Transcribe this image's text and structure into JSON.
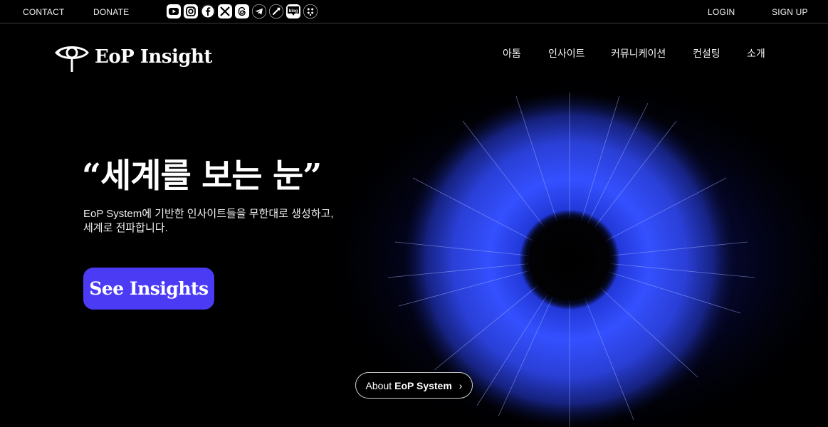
{
  "utility": {
    "contact": "CONTACT",
    "donate": "DONATE",
    "login": "LOGIN",
    "signup": "SIGN UP"
  },
  "social_icons": [
    "youtube-icon",
    "instagram-icon",
    "facebook-icon",
    "x-icon",
    "threads-icon",
    "telegram-icon",
    "link-icon",
    "blog-icon",
    "linktree-icon"
  ],
  "social_blog_label": "blog",
  "logo": {
    "text": "EoP Insight"
  },
  "nav": {
    "items": [
      "아톰",
      "인사이트",
      "커뮤니케이션",
      "컨설팅",
      "소개"
    ]
  },
  "hero": {
    "title": "“세계를 보는 눈”",
    "subtitle_line1": "EoP System에 기반한 인사이트들을 무한대로 생성하고,",
    "subtitle_line2": "세계로 전파합니다.",
    "cta": "See Insights",
    "about_prefix": "About",
    "about_strong": "EoP System",
    "about_chevron": "›"
  },
  "colors": {
    "background": "#000000",
    "cta": "#4b3bf5",
    "iris": "#2a3cff"
  }
}
